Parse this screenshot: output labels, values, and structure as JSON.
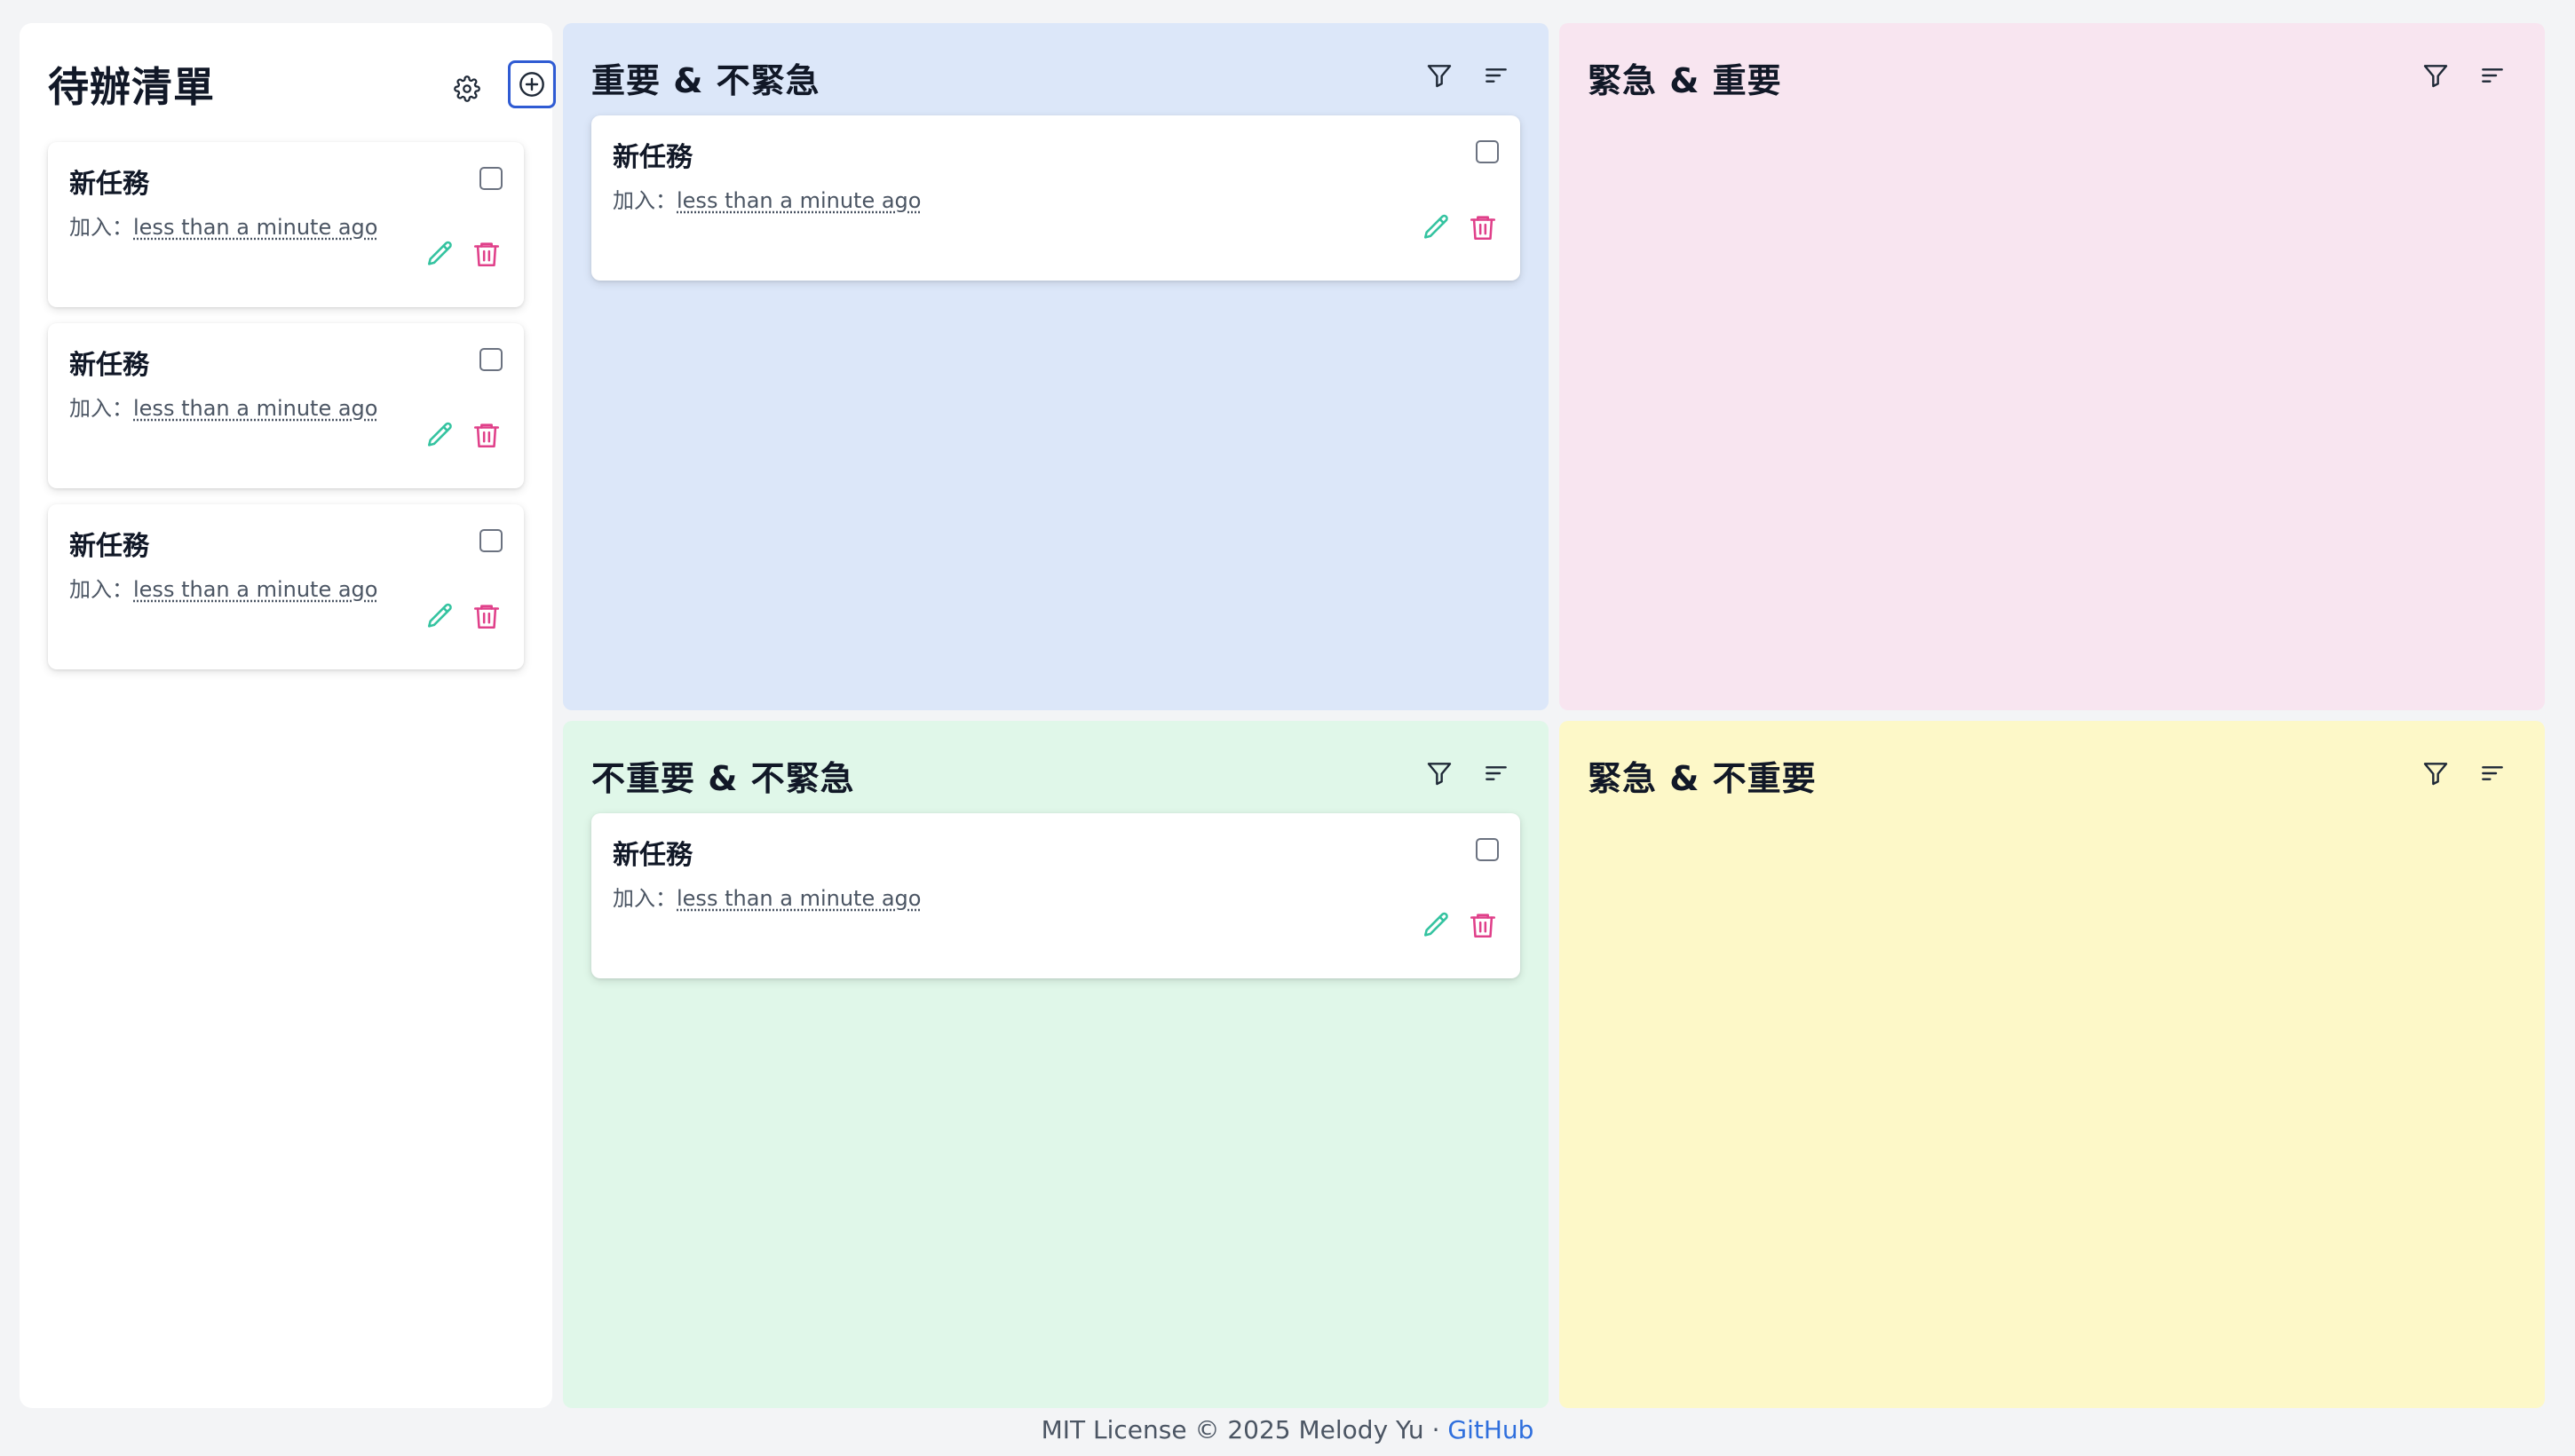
{
  "sidebar": {
    "title": "待辦清單",
    "settings_icon": "gear-icon",
    "add_icon": "plus-circle-icon",
    "tasks": [
      {
        "title": "新任務",
        "added_label": "加入：",
        "time": "less than a minute ago"
      },
      {
        "title": "新任務",
        "added_label": "加入：",
        "time": "less than a minute ago"
      },
      {
        "title": "新任務",
        "added_label": "加入：",
        "time": "less than a minute ago"
      }
    ]
  },
  "quadrants": {
    "important_not_urgent": {
      "title": "重要 & 不緊急",
      "bg": "#dce7f9",
      "tasks": [
        {
          "title": "新任務",
          "added_label": "加入：",
          "time": "less than a minute ago"
        }
      ]
    },
    "urgent_important": {
      "title": "緊急 & 重要",
      "bg": "#f8e5f0",
      "tasks": []
    },
    "not_important_not_urgent": {
      "title": "不重要 & 不緊急",
      "bg": "#e0f7e9",
      "tasks": [
        {
          "title": "新任務",
          "added_label": "加入：",
          "time": "less than a minute ago"
        }
      ]
    },
    "urgent_not_important": {
      "title": "緊急 & 不重要",
      "bg": "#fdf8c8",
      "tasks": []
    }
  },
  "footer": {
    "text": "MIT License © 2025 Melody Yu · ",
    "link": "GitHub"
  },
  "colors": {
    "edit_icon": "#34c3a0",
    "delete_icon": "#e0408a",
    "add_border": "#2f5bd3",
    "link": "#2f6fdd"
  }
}
